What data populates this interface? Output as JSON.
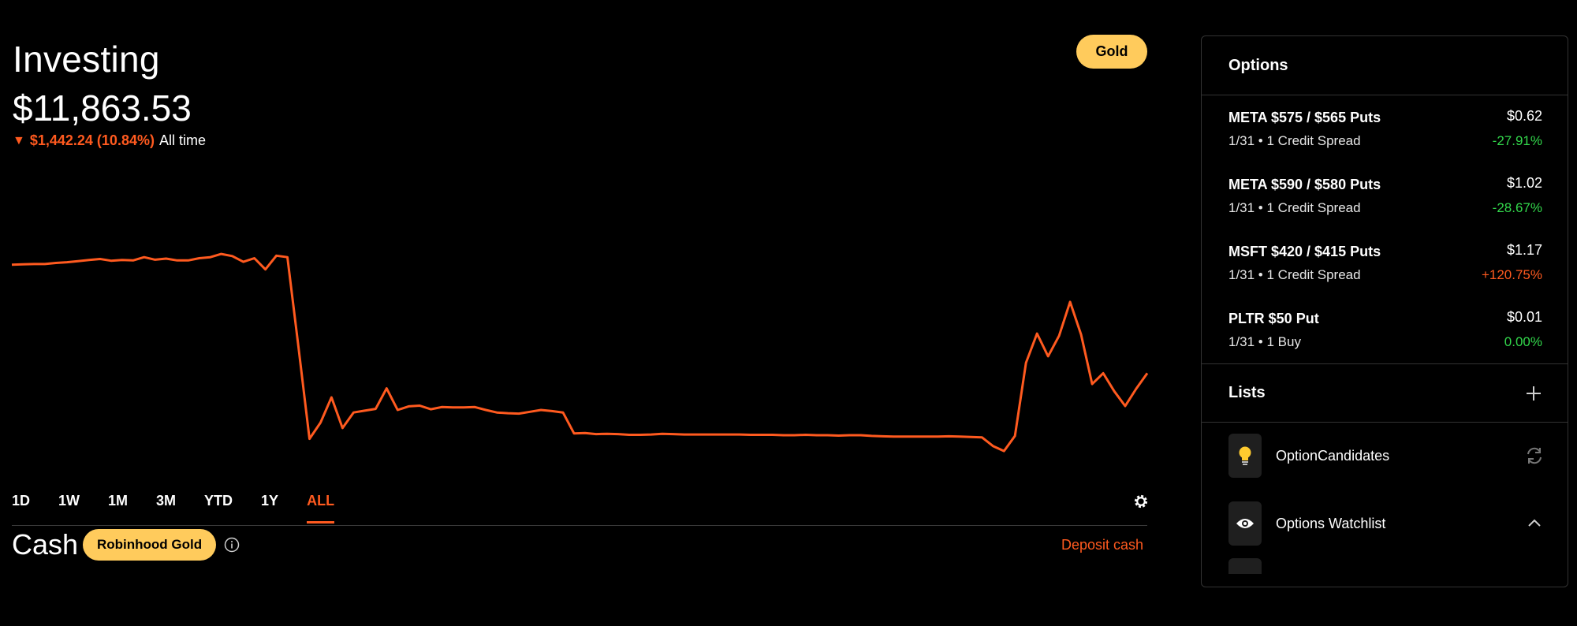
{
  "header": {
    "title": "Investing",
    "value": "$11,863.53",
    "change_arrow": "▼",
    "change_amount": "$1,442.24 (10.84%)",
    "change_period": "All time",
    "gold_button": "Gold"
  },
  "chart_data": {
    "type": "line",
    "color": "#ff5a1f",
    "values": [
      15780,
      15790,
      15800,
      15800,
      15830,
      15850,
      15880,
      15910,
      15940,
      15890,
      15910,
      15900,
      15990,
      15920,
      15950,
      15900,
      15900,
      15960,
      15990,
      16080,
      16020,
      15860,
      15960,
      15650,
      16030,
      15990,
      13500,
      10950,
      11400,
      12100,
      11250,
      11680,
      11730,
      11780,
      12350,
      11750,
      11850,
      11870,
      11770,
      11830,
      11820,
      11820,
      11830,
      11750,
      11680,
      11660,
      11650,
      11700,
      11750,
      11720,
      11680,
      11100,
      11110,
      11080,
      11090,
      11080,
      11060,
      11060,
      11070,
      11090,
      11080,
      11070,
      11070,
      11070,
      11070,
      11070,
      11070,
      11060,
      11060,
      11060,
      11050,
      11050,
      11060,
      11050,
      11050,
      11040,
      11050,
      11050,
      11030,
      11020,
      11010,
      11010,
      11010,
      11010,
      11010,
      11020,
      11010,
      11000,
      10990,
      10750,
      10610,
      11030,
      13060,
      13870,
      13240,
      13810,
      14750,
      13840,
      12470,
      12770,
      12270,
      11860,
      12340,
      12770
    ]
  },
  "ranges": [
    "1D",
    "1W",
    "1M",
    "3M",
    "YTD",
    "1Y",
    "ALL"
  ],
  "active_range": "ALL",
  "cash": {
    "label": "Cash",
    "gold_badge": "Robinhood Gold",
    "deposit": "Deposit cash"
  },
  "sidebar": {
    "options_title": "Options",
    "options": [
      {
        "name": "META $575 / $565 Puts",
        "sub": "1/31 • 1 Credit Spread",
        "price": "$0.62",
        "pct": "-27.91%",
        "dir": "neg"
      },
      {
        "name": "META $590 / $580 Puts",
        "sub": "1/31 • 1 Credit Spread",
        "price": "$1.02",
        "pct": "-28.67%",
        "dir": "neg"
      },
      {
        "name": "MSFT $420 / $415 Puts",
        "sub": "1/31 • 1 Credit Spread",
        "price": "$1.17",
        "pct": "+120.75%",
        "dir": "pos"
      },
      {
        "name": "PLTR $50 Put",
        "sub": "1/31 • 1 Buy",
        "price": "$0.01",
        "pct": "0.00%",
        "dir": "neg"
      }
    ],
    "lists_title": "Lists",
    "lists": [
      {
        "label": "OptionCandidates",
        "icon": "lightbulb-icon",
        "action": "refresh-icon"
      },
      {
        "label": "Options Watchlist",
        "icon": "eye-icon",
        "action": "chevron-up-icon"
      }
    ]
  },
  "colors": {
    "accent": "#ff5a1f",
    "gold": "#ffcb5c",
    "positive_green": "#32d74b"
  }
}
